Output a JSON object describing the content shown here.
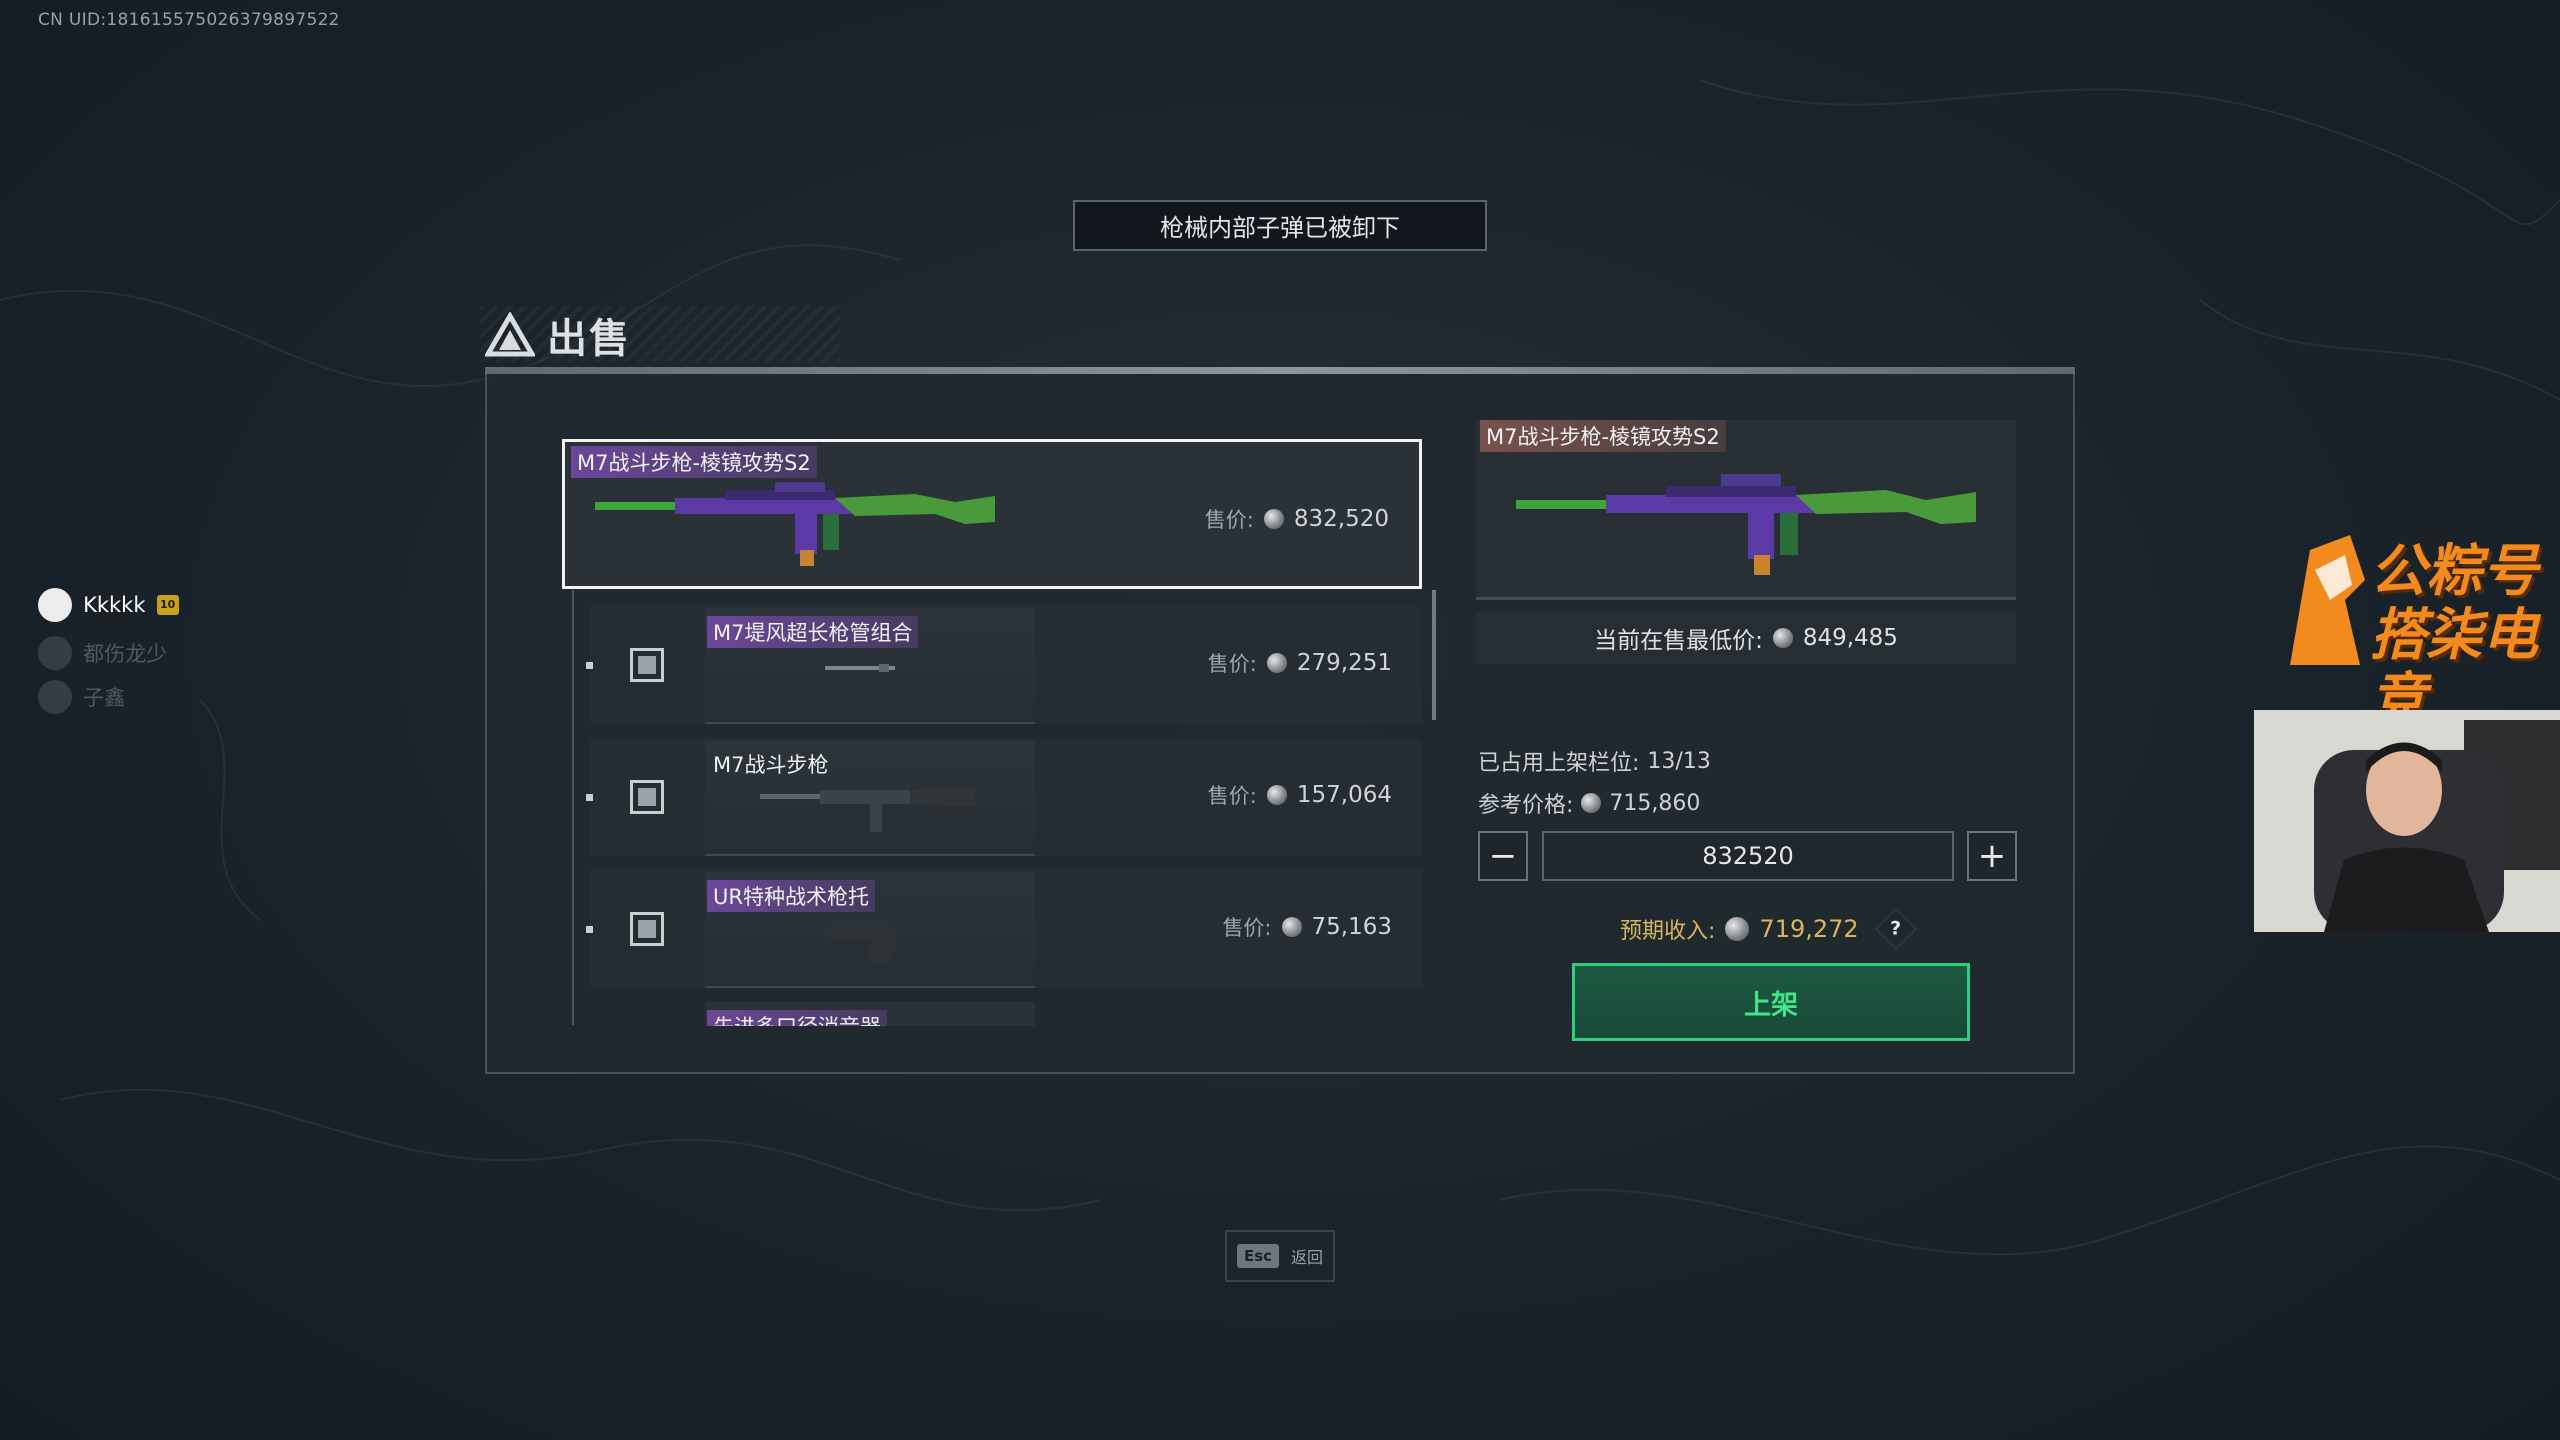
{
  "uid": "CN UID:18161557502637989752​2",
  "toast": "枪械内部子弹已被卸下",
  "dialog": {
    "title": "出售",
    "main_item": {
      "name": "M7战斗步枪-棱镜攻势S2",
      "price_label": "售价:",
      "price": "832,520"
    },
    "sub_items": [
      {
        "name": "M7堤风超长枪管组合",
        "price_label": "售价:",
        "price": "279,251",
        "tagged": true
      },
      {
        "name": "M7战斗步枪",
        "price_label": "售价:",
        "price": "157,064",
        "tagged": false
      },
      {
        "name": "UR特种战术枪托",
        "price_label": "售价:",
        "price": "75,163",
        "tagged": true
      },
      {
        "name": "先进多口径消音器",
        "price_label": "售价:",
        "price": "",
        "tagged": true
      }
    ],
    "preview": {
      "name": "M7战斗步枪-棱镜攻势S2"
    },
    "lowest_label": "当前在售最低价:",
    "lowest_price": "849,485",
    "slots_label": "已占用上架栏位:",
    "slots_value": "13/13",
    "ref_label": "参考价格:",
    "ref_price": "715,860",
    "minus_label": "−",
    "plus_label": "+",
    "price_input": "832520",
    "income_label": "预期收入:",
    "income_value": "719,272",
    "help_label": "?",
    "list_button": "上架"
  },
  "esc": {
    "key": "Esc",
    "label": "返回"
  },
  "team": [
    {
      "name": "Kkkkk",
      "badge": "10"
    },
    {
      "name": "都伤龙少"
    },
    {
      "name": "子鑫"
    }
  ],
  "streamer_logo": {
    "line1": "公粽号",
    "line2": "搭柒电竞"
  },
  "colors": {
    "accent_green": "#2fd07a",
    "gold": "#d6b659",
    "purple_tag": "#784baa"
  }
}
